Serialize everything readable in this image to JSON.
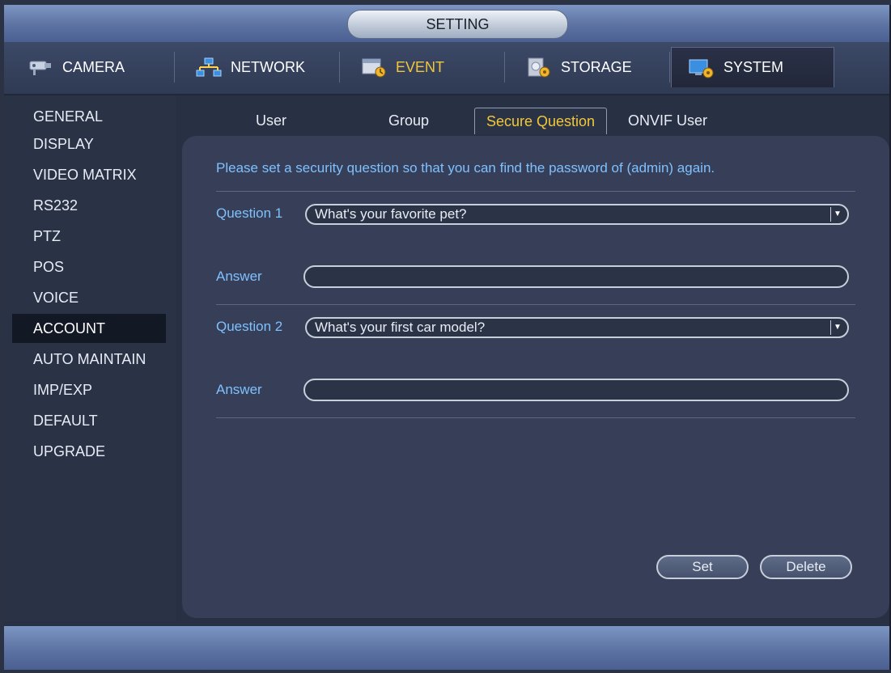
{
  "window": {
    "title": "SETTING"
  },
  "main_tabs": [
    {
      "label": "CAMERA",
      "icon": "camera-icon"
    },
    {
      "label": "NETWORK",
      "icon": "network-icon"
    },
    {
      "label": "EVENT",
      "icon": "event-icon"
    },
    {
      "label": "STORAGE",
      "icon": "storage-icon"
    },
    {
      "label": "SYSTEM",
      "icon": "system-icon"
    }
  ],
  "sidebar": {
    "items": [
      {
        "label": "GENERAL"
      },
      {
        "label": "DISPLAY"
      },
      {
        "label": "VIDEO MATRIX"
      },
      {
        "label": "RS232"
      },
      {
        "label": "PTZ"
      },
      {
        "label": "POS"
      },
      {
        "label": "VOICE"
      },
      {
        "label": "ACCOUNT"
      },
      {
        "label": "AUTO MAINTAIN"
      },
      {
        "label": "IMP/EXP"
      },
      {
        "label": "DEFAULT"
      },
      {
        "label": "UPGRADE"
      }
    ],
    "active": "ACCOUNT"
  },
  "sub_tabs": [
    {
      "label": "User"
    },
    {
      "label": "Group"
    },
    {
      "label": "Secure Question"
    },
    {
      "label": "ONVIF User"
    }
  ],
  "form": {
    "notice": "Please set a security question so that you can find the password of (admin) again.",
    "question1": {
      "label": "Question 1",
      "value": "What's your favorite pet?"
    },
    "answer1": {
      "label": "Answer",
      "value": ""
    },
    "question2": {
      "label": "Question 2",
      "value": "What's your first car model?"
    },
    "answer2": {
      "label": "Answer",
      "value": ""
    }
  },
  "buttons": {
    "set": "Set",
    "delete": "Delete"
  },
  "colors": {
    "accent_yellow": "#f1c73a",
    "label_blue": "#7fc0ff",
    "panel": "#363f57",
    "background": "#2b3244"
  }
}
